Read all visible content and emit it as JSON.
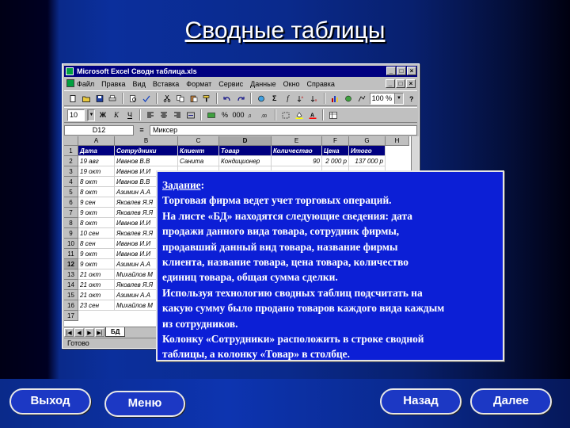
{
  "slide": {
    "title": "Сводные таблицы"
  },
  "excel": {
    "window_title": "Microsoft Excel   Сводн таблица.xls",
    "menu": [
      "Файл",
      "Правка",
      "Вид",
      "Вставка",
      "Формат",
      "Сервис",
      "Данные",
      "Окно",
      "Справка"
    ],
    "zoom": "100 %",
    "font_size": "10",
    "name_box": "D12",
    "formula_value": "Миксер",
    "column_letters": [
      "A",
      "B",
      "C",
      "D",
      "E",
      "F",
      "G",
      "H"
    ],
    "selected_column": "D",
    "headers": [
      "Дата",
      "Сотрудники",
      "Клиент",
      "Товар",
      "Количество",
      "Цена",
      "Итого"
    ],
    "row_numbers": [
      "1",
      "2",
      "3",
      "4",
      "5",
      "6",
      "7",
      "8",
      "9",
      "10",
      "11",
      "12",
      "13",
      "14",
      "15",
      "16",
      "17"
    ],
    "selected_row": "12",
    "rows": [
      {
        "date": "19 авг",
        "employee": "Иванов В.В",
        "client": "Санита",
        "product": "Кондиционер",
        "qty": "90",
        "price": "2 000 р",
        "total": "137 000 р"
      },
      {
        "date": "19 окт",
        "employee": "Иванов И.И",
        "client": "",
        "product": "",
        "qty": "",
        "price": "",
        "total": ""
      },
      {
        "date": "8 окт",
        "employee": "Иванов В.В",
        "client": "",
        "product": "",
        "qty": "",
        "price": "",
        "total": ""
      },
      {
        "date": "8 окт",
        "employee": "Азимин А.А",
        "client": "",
        "product": "",
        "qty": "",
        "price": "",
        "total": ""
      },
      {
        "date": "9 сен",
        "employee": "Яковлев Я.Я",
        "client": "",
        "product": "",
        "qty": "",
        "price": "",
        "total": ""
      },
      {
        "date": "9 окт",
        "employee": "Яковлев Я.Я",
        "client": "",
        "product": "",
        "qty": "",
        "price": "",
        "total": ""
      },
      {
        "date": "8 окт",
        "employee": "Иванов И.И",
        "client": "",
        "product": "",
        "qty": "",
        "price": "",
        "total": ""
      },
      {
        "date": "10 сен",
        "employee": "Яковлев Я.Я",
        "client": "",
        "product": "",
        "qty": "",
        "price": "",
        "total": ""
      },
      {
        "date": "8 сен",
        "employee": "Иванов И.И",
        "client": "",
        "product": "",
        "qty": "",
        "price": "",
        "total": ""
      },
      {
        "date": "9 окт",
        "employee": "Иванов И.И",
        "client": "",
        "product": "",
        "qty": "",
        "price": "",
        "total": ""
      },
      {
        "date": "9 окт",
        "employee": "Азимин А.А",
        "client": "",
        "product": "",
        "qty": "",
        "price": "",
        "total": ""
      },
      {
        "date": "21 окт",
        "employee": "Михайлов М",
        "client": "",
        "product": "",
        "qty": "",
        "price": "",
        "total": ""
      },
      {
        "date": "21 окт",
        "employee": "Яковлев Я.Я",
        "client": "",
        "product": "",
        "qty": "",
        "price": "",
        "total": ""
      },
      {
        "date": "21 окт",
        "employee": "Азимин А.А",
        "client": "",
        "product": "",
        "qty": "",
        "price": "",
        "total": ""
      },
      {
        "date": "23 сен",
        "employee": "Михайлов М",
        "client": "",
        "product": "",
        "qty": "",
        "price": "",
        "total": ""
      }
    ],
    "sheet_tab": "БД",
    "status": "Готово"
  },
  "task": {
    "heading": "Задание",
    "lines": [
      "Торговая фирма ведет учет торговых операций.",
      "На листе «БД» находятся  следующие сведения: дата",
      "продажи данного вида товара, сотрудник фирмы,",
      "продавший данный вид товара,  название фирмы",
      "клиента,  название товара,  цена товара, количество",
      "единиц товара, общая сумма сделки.",
      "Используя технологию сводных таблиц подсчитать на",
      "какую сумму было продано товаров каждого вида каждым",
      "из сотрудников.",
      "Колонку  «Сотрудники» расположить в строке сводной",
      "таблицы, а колонку «Товар» в столбце."
    ]
  },
  "nav": {
    "exit": "Выход",
    "menu": "Меню",
    "back": "Назад",
    "next": "Далее"
  }
}
